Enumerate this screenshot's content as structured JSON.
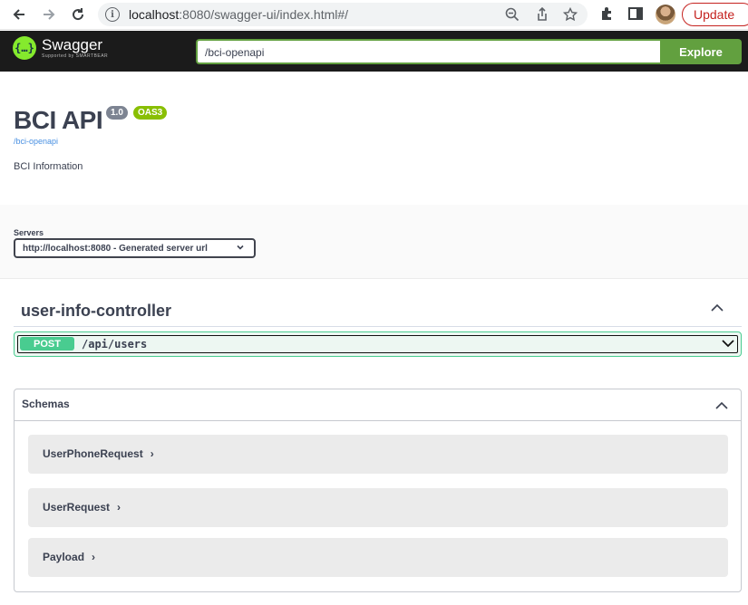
{
  "browser": {
    "url_host": "localhost",
    "url_rest": ":8080/swagger-ui/index.html#/",
    "update_label": "Update"
  },
  "topbar": {
    "logo_title": "Swagger",
    "logo_sub": "Supported by SMARTBEAR",
    "spec_url": "/bci-openapi",
    "explore_label": "Explore"
  },
  "info": {
    "title": "BCI API",
    "version": "1.0",
    "oas": "OAS3",
    "link": "/bci-openapi",
    "description": "BCI Information"
  },
  "servers": {
    "label": "Servers",
    "selected": "http://localhost:8080 - Generated server url"
  },
  "controller": {
    "title": "user-info-controller",
    "operations": [
      {
        "method": "POST",
        "path": "/api/users"
      }
    ]
  },
  "schemas": {
    "title": "Schemas",
    "models": [
      "UserPhoneRequest",
      "UserRequest",
      "Payload"
    ]
  },
  "colors": {
    "topbar_bg": "#1b1b1b",
    "accent_green": "#62a03f",
    "post_green": "#49cc90",
    "badge_grey": "#7d8492",
    "badge_oas": "#89bf04"
  }
}
